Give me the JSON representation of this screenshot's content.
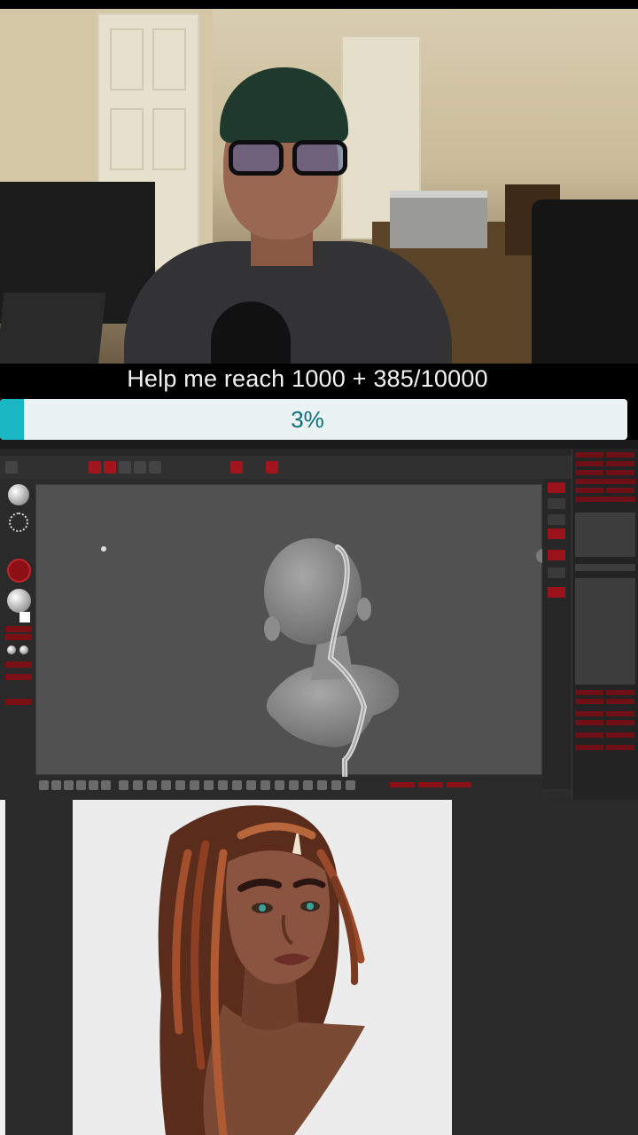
{
  "stream_overlay": {
    "goal_text": "Help me reach 1000 +  385/10000",
    "progress_percent_label": "3%",
    "progress_fraction": 0.0385,
    "bar_fill_color": "#19b7c4",
    "bar_track_color": "#eaf2f2"
  },
  "zbrush": {
    "tool_icons": [
      "brush-sphere-icon",
      "stroke-dots-icon",
      "material-sphere-icon",
      "color-swatch-icon"
    ],
    "model": "bust-with-zsphere-curve",
    "accent_color": "#a3151c"
  },
  "artwork": {
    "subject": "stylized-portrait-painting"
  }
}
